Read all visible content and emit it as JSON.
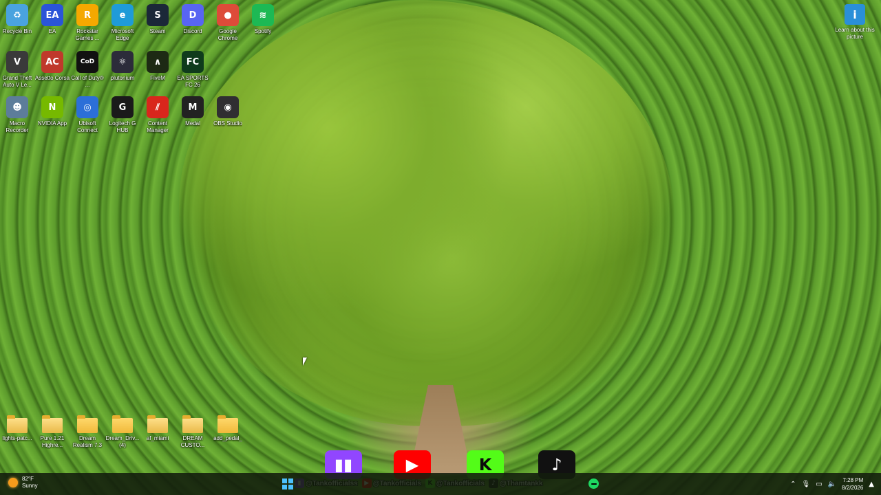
{
  "desktop": {
    "icons_row1": [
      {
        "label": "Recycle Bin",
        "icon": "recycle-bin-icon",
        "glyph": "♻",
        "color": "#4aa3df"
      },
      {
        "label": "EA",
        "icon": "ea-icon",
        "glyph": "EA",
        "color": "#2b55d8"
      },
      {
        "label": "Rockstar Games ...",
        "icon": "rockstar-icon",
        "glyph": "R",
        "color": "#f5a800"
      },
      {
        "label": "Microsoft Edge",
        "icon": "edge-icon",
        "glyph": "e",
        "color": "#1f9bd8"
      },
      {
        "label": "Steam",
        "icon": "steam-icon",
        "glyph": "S",
        "color": "#1b2838"
      },
      {
        "label": "Discord",
        "icon": "discord-icon",
        "glyph": "D",
        "color": "#5865f2"
      },
      {
        "label": "Google Chrome",
        "icon": "chrome-icon",
        "glyph": "●",
        "color": "#dd4b39"
      },
      {
        "label": "Spotify",
        "icon": "spotify-icon",
        "glyph": "≋",
        "color": "#1db954"
      }
    ],
    "icons_row2": [
      {
        "label": "Grand Theft Auto V Le...",
        "icon": "gta-icon",
        "glyph": "V",
        "color": "#3a3a3a"
      },
      {
        "label": "Assetto Corsa",
        "icon": "assetto-corsa-icon",
        "glyph": "AC",
        "color": "#c0392b"
      },
      {
        "label": "Call of Duty® ...",
        "icon": "call-of-duty-icon",
        "glyph": "CoD",
        "color": "#111111"
      },
      {
        "label": "plutonium",
        "icon": "plutonium-icon",
        "glyph": "⚛",
        "color": "#2c2c3a"
      },
      {
        "label": "FiveM",
        "icon": "fivem-icon",
        "glyph": "∧",
        "color": "#1d2a14"
      },
      {
        "label": "EA SPORTS FC 26",
        "icon": "ea-fc-icon",
        "glyph": "FC",
        "color": "#0f3b1c"
      }
    ],
    "icons_row3": [
      {
        "label": "Macro Recorder",
        "icon": "macro-recorder-icon",
        "glyph": "☻",
        "color": "#5d7d9a"
      },
      {
        "label": "NVIDIA App",
        "icon": "nvidia-icon",
        "glyph": "N",
        "color": "#76b900"
      },
      {
        "label": "Ubisoft Connect",
        "icon": "ubisoft-icon",
        "glyph": "◎",
        "color": "#2c6fd8"
      },
      {
        "label": "Logitech G HUB",
        "icon": "logitech-icon",
        "glyph": "G",
        "color": "#1a1a1a"
      },
      {
        "label": "Content Manager",
        "icon": "content-manager-icon",
        "glyph": "⫽",
        "color": "#d9261c"
      },
      {
        "label": "Medal",
        "icon": "medal-icon",
        "glyph": "M",
        "color": "#222222"
      },
      {
        "label": "OBS Studio",
        "icon": "obs-icon",
        "glyph": "◉",
        "color": "#302e31"
      }
    ],
    "icons_bottom": [
      {
        "label": "lights-patc...",
        "icon": "file-icon"
      },
      {
        "label": "Pure 1.21 Highre...",
        "icon": "file-icon"
      },
      {
        "label": "Dream Realism 7.3",
        "icon": "folder-icon"
      },
      {
        "label": "Dream_Driv... (4)",
        "icon": "folder-icon"
      },
      {
        "label": "af_miami",
        "icon": "file-icon"
      },
      {
        "label": "DREAM CUSTO...",
        "icon": "file-icon"
      },
      {
        "label": "add_pedal_",
        "icon": "folder-icon"
      }
    ],
    "learn_label": "Learn about this picture"
  },
  "overlay": {
    "big": [
      {
        "name": "twitch-logo-icon",
        "glyph": "▮▮",
        "color": "#9146ff"
      },
      {
        "name": "youtube-logo-icon",
        "glyph": "▶",
        "color": "#ff0000"
      },
      {
        "name": "kick-logo-icon",
        "glyph": "K",
        "color": "#53fc18"
      },
      {
        "name": "tiktok-logo-icon",
        "glyph": "♪",
        "color": "#111111"
      }
    ],
    "handles": [
      {
        "name": "twitch-handle",
        "text": "@Tankofficialss",
        "color": "#9146ff",
        "glyph": "▮"
      },
      {
        "name": "youtube-handle",
        "text": "@Tankofficials",
        "color": "#ff0000",
        "glyph": "▶"
      },
      {
        "name": "kick-handle",
        "text": "@Tankofficials",
        "color": "#53fc18",
        "glyph": "K"
      },
      {
        "name": "tiktok-handle",
        "text": "@Thamtankk",
        "color": "#111111",
        "glyph": "♪"
      }
    ]
  },
  "taskbar": {
    "weather_temp": "82°F",
    "weather_desc": "Sunny",
    "time": "7:28 PM",
    "date": "8/2/2026"
  }
}
